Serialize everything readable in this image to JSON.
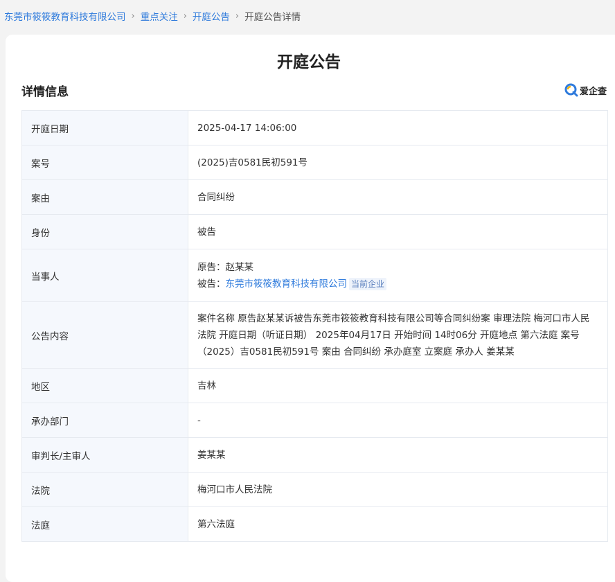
{
  "breadcrumb": {
    "items": [
      "东莞市筱筱教育科技有限公司",
      "重点关注",
      "开庭公告"
    ],
    "current": "开庭公告详情",
    "separator": "›"
  },
  "page_title": "开庭公告",
  "section_title": "详情信息",
  "brand": {
    "name": "爱企查",
    "icon": "aiqicha-logo-icon"
  },
  "details": {
    "date_label": "开庭日期",
    "date_value": "2025-04-17 14:06:00",
    "case_no_label": "案号",
    "case_no_value": "(2025)吉0581民初591号",
    "cause_label": "案由",
    "cause_value": "合同纠纷",
    "role_label": "身份",
    "role_value": "被告",
    "parties_label": "当事人",
    "plaintiff_prefix": "原告：",
    "plaintiff_name": "赵某某",
    "defendant_prefix": "被告：",
    "defendant_name": "东莞市筱筱教育科技有限公司",
    "defendant_tag": "当前企业",
    "content_label": "公告内容",
    "content_value": "案件名称 原告赵某某诉被告东莞市筱筱教育科技有限公司等合同纠纷案 审理法院 梅河口市人民法院 开庭日期（听证日期） 2025年04月17日 开始时间 14时06分 开庭地点 第六法庭 案号 （2025）吉0581民初591号 案由 合同纠纷 承办庭室 立案庭 承办人 姜某某",
    "region_label": "地区",
    "region_value": "吉林",
    "department_label": "承办部门",
    "department_value": "-",
    "judge_label": "审判长/主审人",
    "judge_value": "姜某某",
    "court_label": "法院",
    "court_value": "梅河口市人民法院",
    "courtroom_label": "法庭",
    "courtroom_value": "第六法庭"
  },
  "colors": {
    "link": "#2f7bdc",
    "label_bg": "#f5f8fd",
    "border": "#e6eaf0"
  }
}
